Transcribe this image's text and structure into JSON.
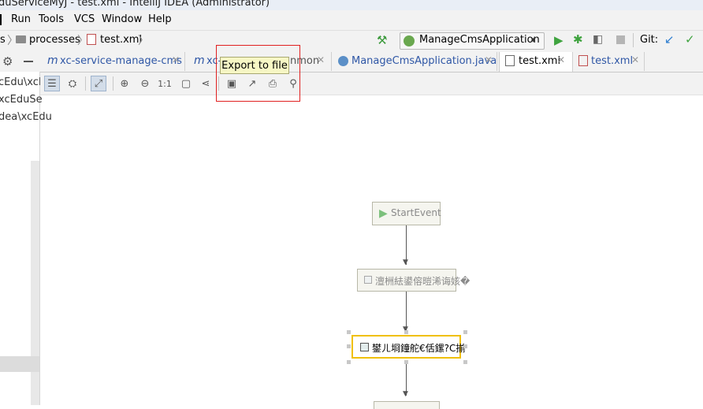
{
  "window": {
    "title": "duServiceMyJ - test.xml - IntelliJ IDEA (Administrator)"
  },
  "menu": [
    "Run",
    "Tools",
    "VCS",
    "Window",
    "Help"
  ],
  "navbar": {
    "crumbs": [
      "s",
      "processes",
      "test.xml"
    ],
    "run_config": "ManageCmsApplication",
    "git_label": "Git:"
  },
  "tabs": [
    {
      "label": "xc-service-manage-cms"
    },
    {
      "label": "xc-"
    },
    {
      "label": "nmon"
    },
    {
      "label": "ManageCmsApplication.java"
    },
    {
      "label": "test.xml"
    },
    {
      "label": "test.xml"
    }
  ],
  "leftpanel": {
    "lines": [
      "cEdu\\xcE",
      "xcEduSe",
      "dea\\xcEdu"
    ]
  },
  "toolbar": {
    "zoom_actual": "1:1",
    "tooltip": "Export to file"
  },
  "diagram": {
    "start_event": "StartEvent",
    "task1": "澶栦紶鍙傛暟浠诲姟�",
    "task2": "鐢ㄦ埛鐘舵€佸鏍?C揃"
  },
  "colors": {
    "accent_blue": "#2f57a6",
    "highlight": "#e02020",
    "selected_node_border": "#f0c000"
  }
}
